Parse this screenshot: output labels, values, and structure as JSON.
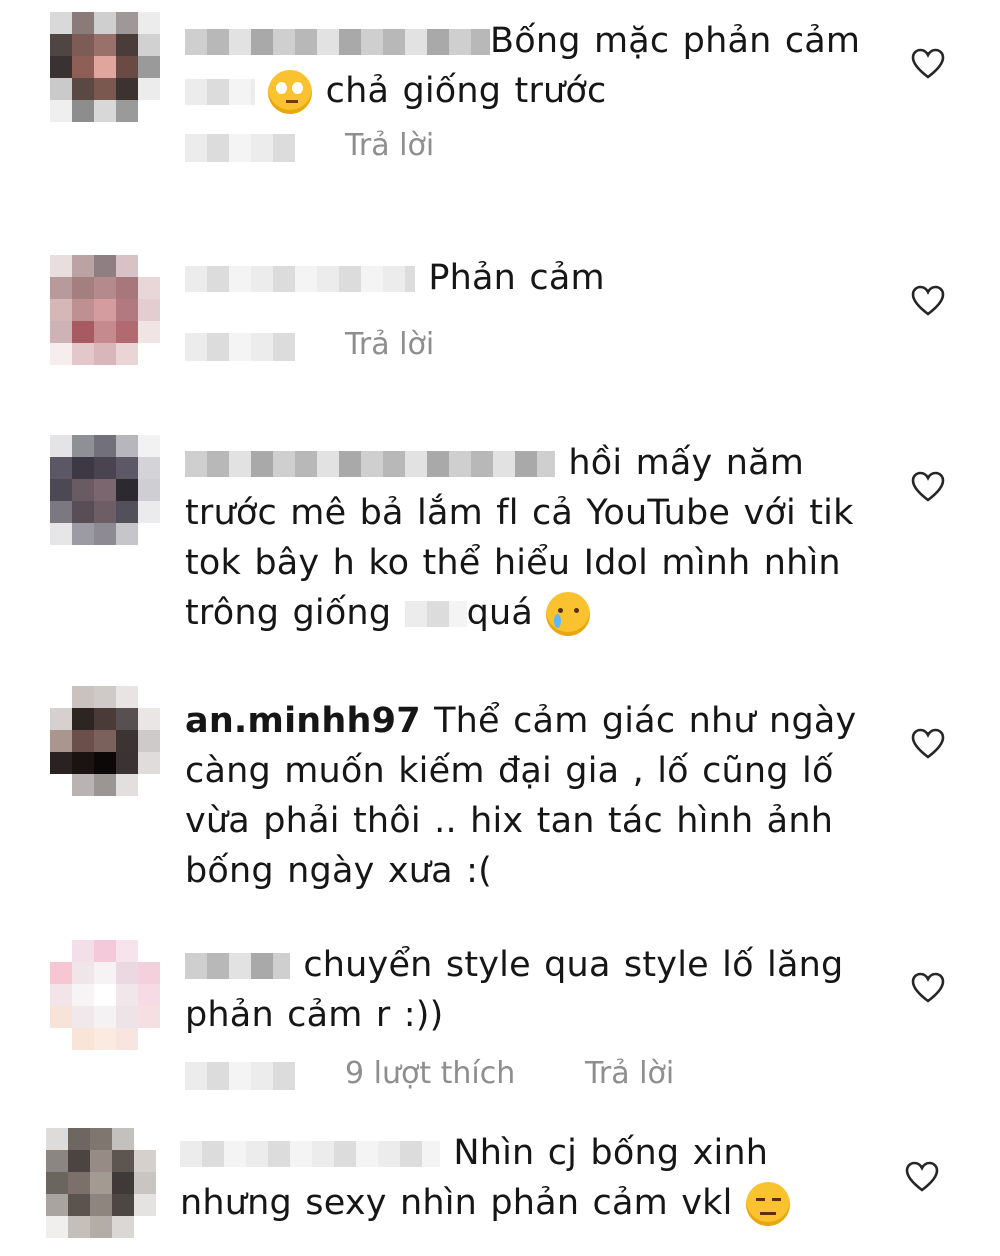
{
  "comments": [
    {
      "text_parts": [
        "Bống mặc phản cảm",
        "chả giống trước"
      ],
      "reply_label": "Trả lời"
    },
    {
      "text": "Phản cảm",
      "reply_label": "Trả lời"
    },
    {
      "text_parts": [
        "hồi mấy năm",
        "trước mê bả lắm fl cả YouTube với tik",
        "tok bây h ko thể hiểu Idol mình nhìn",
        "trông giống",
        "quá"
      ]
    },
    {
      "username": "an.minhh97",
      "text_parts": [
        "Thể cảm giác như ngày",
        "càng muốn kiếm đại gia , lố cũng lố",
        "vừa phải thôi .. hix tan tác hình ảnh",
        "bống ngày xưa :("
      ]
    },
    {
      "text_parts": [
        "chuyển style qua style lố lăng",
        "phản cảm r :))"
      ],
      "likes_label": "9 lượt thích",
      "reply_label": "Trả lời"
    },
    {
      "text_parts": [
        "Nhìn cj bống xinh",
        "nhưng sexy nhìn phản cảm vkl"
      ]
    }
  ],
  "icons": {
    "like": "heart-icon",
    "avatar": "avatar-pixelated"
  },
  "colors": {
    "meta": "#8e8e8e",
    "text": "#161616",
    "heart": "#262626"
  }
}
